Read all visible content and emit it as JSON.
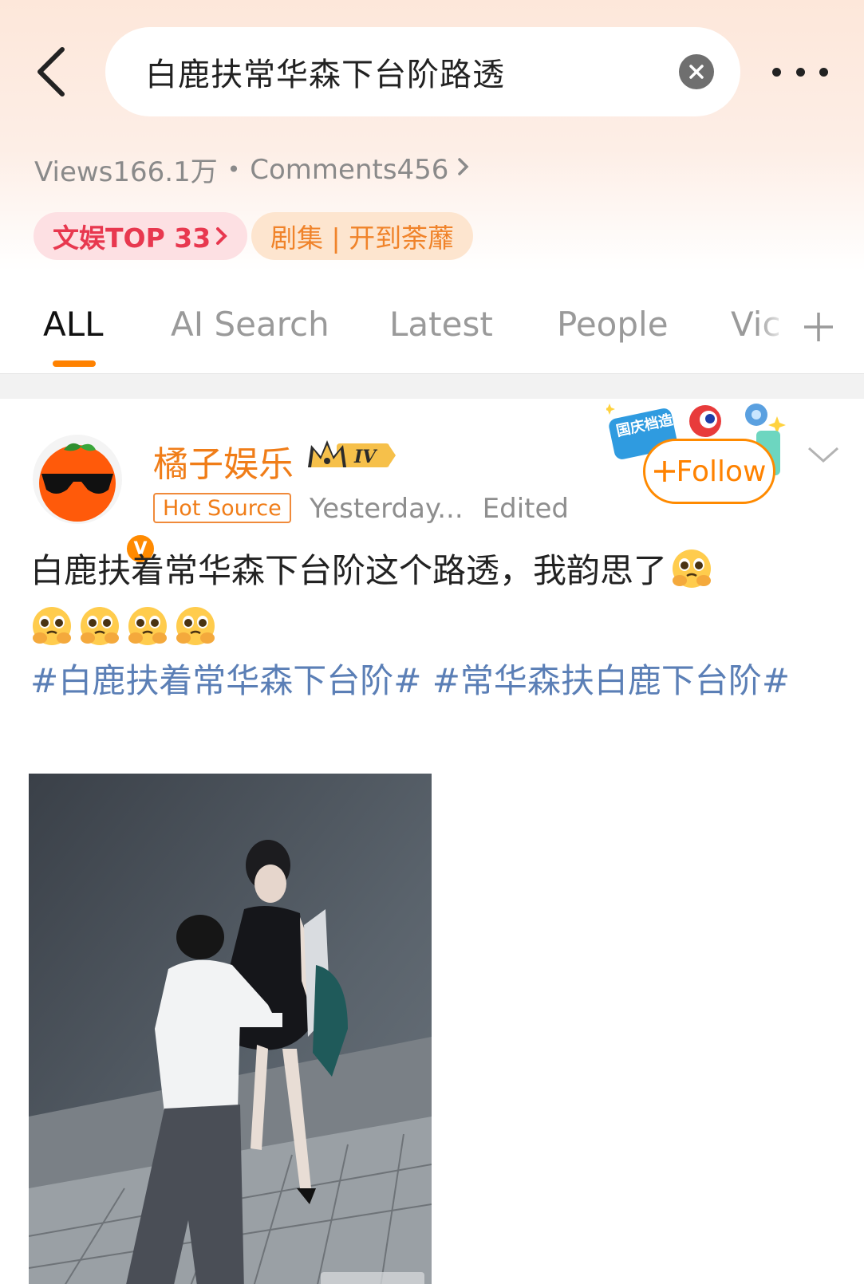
{
  "search": {
    "query": "白鹿扶常华森下台阶路透"
  },
  "stats": {
    "views": "Views166.1万",
    "separator": "•",
    "comments": "Comments456"
  },
  "chips": {
    "rank": "文娱TOP 33",
    "tag": "剧集 | 开到荼蘼"
  },
  "tabs": [
    {
      "label": "ALL",
      "active": true
    },
    {
      "label": "AI Search"
    },
    {
      "label": "Latest"
    },
    {
      "label": "People"
    },
    {
      "label": "Vic"
    }
  ],
  "post": {
    "author": "橘子娱乐",
    "level_badge": "IV",
    "source_badge": "Hot Source",
    "time": "Yesterday...",
    "edited": "Edited",
    "follow_label": "Follow",
    "follow_deco_text": "国庆档造梗",
    "text": "白鹿扶着常华森下台阶这个路透，我韵思了",
    "topics": "#白鹿扶着常华森下台阶# #常华森扶白鹿下台阶#",
    "emoji": "pleading-hug-emoji",
    "emoji_count_line2": 4
  },
  "colors": {
    "accent": "#ff8200",
    "link": "#5b7fb6",
    "username": "#f07d18",
    "rank": "#e8384f"
  }
}
